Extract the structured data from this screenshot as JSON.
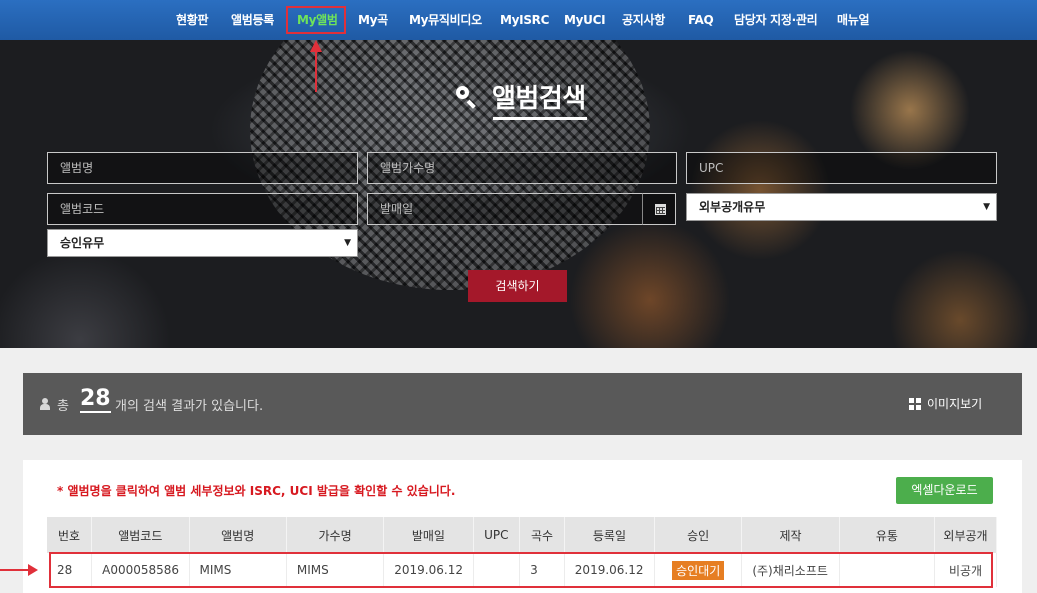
{
  "nav": {
    "items": [
      {
        "label": "현황판",
        "active": false
      },
      {
        "label": "앨범등록",
        "active": false
      },
      {
        "label": "My앨범",
        "active": true
      },
      {
        "label": "My곡",
        "active": false
      },
      {
        "label": "My뮤직비디오",
        "active": false
      },
      {
        "label": "MyISRC",
        "active": false
      },
      {
        "label": "MyUCI",
        "active": false
      },
      {
        "label": "공지사항",
        "active": false
      },
      {
        "label": "FAQ",
        "active": false
      },
      {
        "label": "담당자 지정·관리",
        "active": false
      },
      {
        "label": "매뉴얼",
        "active": false
      }
    ],
    "active_color": "#6fe35a"
  },
  "hero": {
    "title": "앨범검색",
    "search_icon": "search-icon"
  },
  "search_form": {
    "album_name_placeholder": "앨범명",
    "artist_placeholder": "앨범가수명",
    "upc_placeholder": "UPC",
    "album_code_placeholder": "앨범코드",
    "release_date_placeholder": "발매일",
    "public_select": "외부공개유무",
    "approval_select": "승인유무",
    "search_button": "검색하기",
    "calendar_icon": "calendar-icon"
  },
  "results": {
    "prefix": "총",
    "count": "28",
    "suffix": "개의 검색 결과가 있습니다.",
    "image_view": "이미지보기"
  },
  "table": {
    "notice": "* 앨범명을 클릭하여 앨범 세부정보와 ISRC, UCI 발급을 확인할 수 있습니다.",
    "excel_download": "엑셀다운로드",
    "headers": [
      "번호",
      "앨범코드",
      "앨범명",
      "가수명",
      "발매일",
      "UPC",
      "곡수",
      "등록일",
      "승인",
      "제작",
      "유통",
      "외부공개"
    ],
    "rows": [
      {
        "no": "28",
        "code": "A000058586",
        "album": "MIMS",
        "artist": "MIMS",
        "release": "2019.06.12",
        "upc": "",
        "tracks": "3",
        "registered": "2019.06.12",
        "approval": "승인대기",
        "producer": "(주)채리소프트",
        "distributor": "",
        "public": "비공개"
      }
    ]
  },
  "colors": {
    "nav_bg": "#2466b4",
    "button_red": "#a4182a",
    "excel_green": "#4cae4c",
    "badge_orange": "#e67e22",
    "notice_red": "#d71920",
    "highlight": "#e0303a"
  }
}
